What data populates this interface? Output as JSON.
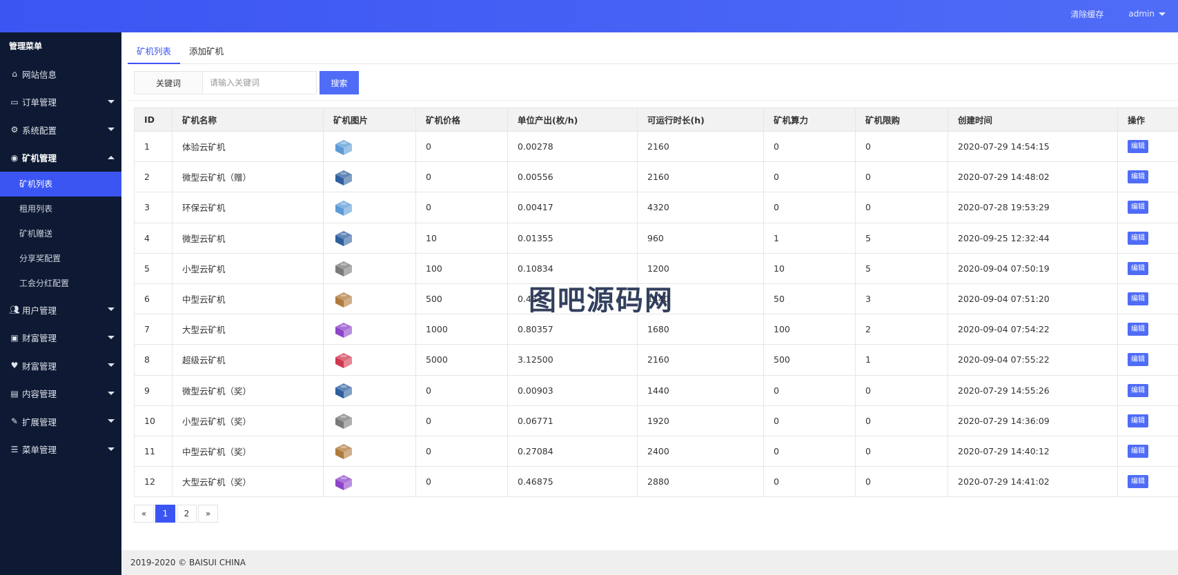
{
  "topbar": {
    "clear_cache": "清除缓存",
    "user": "admin"
  },
  "sidebar": {
    "title": "管理菜单",
    "items": [
      {
        "label": "网站信息",
        "icon": "home-icon"
      },
      {
        "label": "订单管理",
        "icon": "credit-card-icon"
      },
      {
        "label": "系统配置",
        "icon": "cogs-icon"
      },
      {
        "label": "矿机管理",
        "icon": "dashboard-icon"
      },
      {
        "label": "用户管理",
        "icon": "users-icon"
      },
      {
        "label": "财富管理",
        "icon": "money-icon"
      },
      {
        "label": "财富管理",
        "icon": "heartbeat-icon"
      },
      {
        "label": "内容管理",
        "icon": "file-icon"
      },
      {
        "label": "扩展管理",
        "icon": "wrench-icon"
      },
      {
        "label": "菜单管理",
        "icon": "bars-icon"
      }
    ],
    "sub_items": [
      "矿机列表",
      "租用列表",
      "矿机赠送",
      "分享奖配置",
      "工会分红配置"
    ]
  },
  "tabs": [
    "矿机列表",
    "添加矿机"
  ],
  "search": {
    "label": "关键词",
    "placeholder": "请输入关键词",
    "button": "搜索"
  },
  "table": {
    "headers": [
      "ID",
      "矿机名称",
      "矿机图片",
      "矿机价格",
      "单位产出(枚/h)",
      "可运行时长(h)",
      "矿机算力",
      "矿机限购",
      "创建时间",
      "操作"
    ],
    "edit_label": "编辑",
    "rows": [
      {
        "id": "1",
        "name": "体验云矿机",
        "img": "#5b9bd5",
        "price": "0",
        "output": "0.00278",
        "hours": "2160",
        "power": "0",
        "limit": "0",
        "created": "2020-07-29 14:54:15"
      },
      {
        "id": "2",
        "name": "微型云矿机（赠）",
        "img": "#2f5f9e",
        "price": "0",
        "output": "0.00556",
        "hours": "2160",
        "power": "0",
        "limit": "0",
        "created": "2020-07-29 14:48:02"
      },
      {
        "id": "3",
        "name": "环保云矿机",
        "img": "#5b9bd5",
        "price": "0",
        "output": "0.00417",
        "hours": "4320",
        "power": "0",
        "limit": "0",
        "created": "2020-07-28 19:53:29"
      },
      {
        "id": "4",
        "name": "微型云矿机",
        "img": "#2f5f9e",
        "price": "10",
        "output": "0.01355",
        "hours": "960",
        "power": "1",
        "limit": "5",
        "created": "2020-09-25 12:32:44"
      },
      {
        "id": "5",
        "name": "小型云矿机",
        "img": "#7a7a7a",
        "price": "100",
        "output": "0.10834",
        "hours": "1200",
        "power": "10",
        "limit": "5",
        "created": "2020-09-04 07:50:19"
      },
      {
        "id": "6",
        "name": "中型云矿机",
        "img": "#b07a3c",
        "price": "500",
        "output": "0.45",
        "hours": "1440",
        "power": "50",
        "limit": "3",
        "created": "2020-09-04 07:51:20"
      },
      {
        "id": "7",
        "name": "大型云矿机",
        "img": "#8e44c9",
        "price": "1000",
        "output": "0.80357",
        "hours": "1680",
        "power": "100",
        "limit": "2",
        "created": "2020-09-04 07:54:22"
      },
      {
        "id": "8",
        "name": "超级云矿机",
        "img": "#d0384f",
        "price": "5000",
        "output": "3.12500",
        "hours": "2160",
        "power": "500",
        "limit": "1",
        "created": "2020-09-04 07:55:22"
      },
      {
        "id": "9",
        "name": "微型云矿机（奖）",
        "img": "#2f5f9e",
        "price": "0",
        "output": "0.00903",
        "hours": "1440",
        "power": "0",
        "limit": "0",
        "created": "2020-07-29 14:55:26"
      },
      {
        "id": "10",
        "name": "小型云矿机（奖）",
        "img": "#7a7a7a",
        "price": "0",
        "output": "0.06771",
        "hours": "1920",
        "power": "0",
        "limit": "0",
        "created": "2020-07-29 14:36:09"
      },
      {
        "id": "11",
        "name": "中型云矿机（奖）",
        "img": "#b07a3c",
        "price": "0",
        "output": "0.27084",
        "hours": "2400",
        "power": "0",
        "limit": "0",
        "created": "2020-07-29 14:40:12"
      },
      {
        "id": "12",
        "name": "大型云矿机（奖）",
        "img": "#8e44c9",
        "price": "0",
        "output": "0.46875",
        "hours": "2880",
        "power": "0",
        "limit": "0",
        "created": "2020-07-29 14:41:02"
      }
    ]
  },
  "pagination": {
    "prev": "«",
    "pages": [
      "1",
      "2"
    ],
    "current": "1",
    "next": "»"
  },
  "footer": "2019-2020 © BAISUI CHINA",
  "watermark": "图吧源码网"
}
